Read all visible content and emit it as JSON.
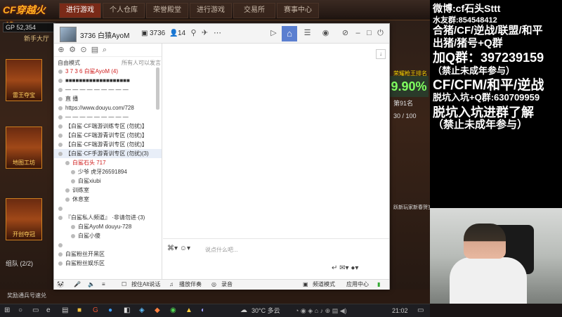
{
  "game": {
    "logo": "CF穿越火线",
    "tabs": [
      "进行游戏",
      "个人仓库",
      "荣誉殿堂",
      "进行游戏",
      "交易所",
      "赛事中心"
    ],
    "gp_label": "GP 52,354",
    "hall": "新手大厅",
    "left_cards": [
      "雷王夺宝",
      "地图工坊",
      "开创夺冠"
    ],
    "squad": "组队 (2/2)",
    "right_rank_label": "荣耀枪王排名",
    "right_percent": "9.90%",
    "right_rank": "第91名",
    "right_ratio": "30 / 100",
    "right_bottom": "跃新玩家新春贺岁 进行中",
    "bottom_strip": "奖励通兵号速兑"
  },
  "chat": {
    "header": {
      "channel": "3736 白猿AyoM",
      "room": "3736",
      "people": "14"
    },
    "mode_left": "自由模式",
    "mode_right": "所有人可以发言",
    "rows": [
      {
        "text": "3 7 3 6  白鲨AyoM (4)",
        "style": "red"
      },
      {
        "text": "■■■■■■■■■■■■■■■■■■■",
        "style": ""
      },
      {
        "text": "— — — — — — — — —",
        "style": ""
      },
      {
        "text": "直  播",
        "style": ""
      },
      {
        "text": "https://www.douyu.com/728",
        "style": ""
      },
      {
        "text": "— — — — — — — — —",
        "style": ""
      },
      {
        "text": "【白鲨·CF端游训练专区  (勿扰)】",
        "style": ""
      },
      {
        "text": "【白鲨·CF端游青训专区  (勿扰)】",
        "style": ""
      },
      {
        "text": "【白鲨·CF端游青训专区  (勿扰)】",
        "style": ""
      },
      {
        "text": "【白鲨·CF手游青训专区  (勿扰)(3)",
        "style": "sel"
      },
      {
        "text": "白鲨石头  717",
        "style": "red ind1"
      },
      {
        "text": "少爷  虎牙26591894",
        "style": "ind2"
      },
      {
        "text": "白鲨xiubi",
        "style": "ind2"
      },
      {
        "text": "训练室",
        "style": "ind1"
      },
      {
        "text": "休息室",
        "style": "ind1"
      },
      {
        "text": "",
        "style": ""
      },
      {
        "text": "『白鲨私人频道』  ·非请勿进·(3)",
        "style": ""
      },
      {
        "text": "白鲨AyoM  douyu-728",
        "style": "ind2"
      },
      {
        "text": "白鲨小傻",
        "style": "ind2"
      },
      {
        "text": "",
        "style": ""
      },
      {
        "text": "白鲨粉丝开黑区",
        "style": ""
      },
      {
        "text": "白鲨粉丝娱乐区",
        "style": ""
      }
    ],
    "compose_placeholder": "说点什么吧...",
    "footer": {
      "ptt": "按住Alt说话",
      "music": "播放伴奏",
      "record": "录音",
      "mode": "频道模式",
      "app": "应用中心"
    }
  },
  "overlay": {
    "lines": [
      "微博:cf石头Sttt",
      "水友群:854548412",
      "合猪/CF/逆战/联盟/和平",
      "出猪/猪号+Q群",
      "加Q群：397239159",
      "（禁止未成年参与）",
      "CF/CFM/和平/逆战",
      "脱坑入坑+Q群:630709959",
      "脱坑入坑进群了解",
      "（禁止未成年参与）"
    ]
  },
  "taskbar": {
    "weather": "30°C 多云",
    "time": "21:02"
  }
}
